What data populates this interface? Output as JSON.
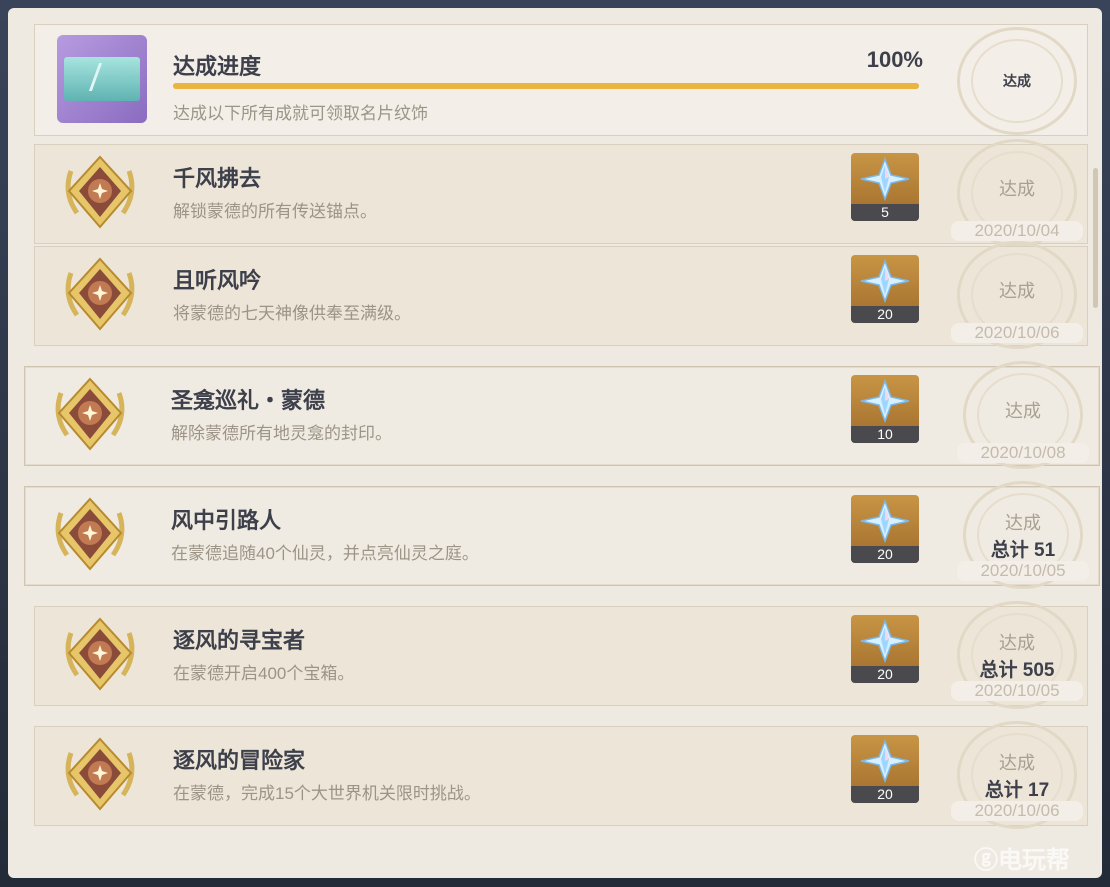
{
  "summary": {
    "title": "达成进度",
    "percent_text": "100%",
    "progress": 1.0,
    "description": "达成以下所有成就可领取名片纹饰",
    "stamp_label": "达成"
  },
  "achievements": [
    {
      "title": "千风拂去",
      "desc": "解锁蒙德的所有传送锚点。",
      "reward": "5",
      "stamp": "达成",
      "total": "",
      "date": "2020/10/04"
    },
    {
      "title": "且听风吟",
      "desc": "将蒙德的七天神像供奉至满级。",
      "reward": "20",
      "stamp": "达成",
      "total": "",
      "date": "2020/10/06"
    },
    {
      "title": "圣龛巡礼・蒙德",
      "desc": "解除蒙德所有地灵龛的封印。",
      "reward": "10",
      "stamp": "达成",
      "total": "",
      "date": "2020/10/08"
    },
    {
      "title": "风中引路人",
      "desc": "在蒙德追随40个仙灵，并点亮仙灵之庭。",
      "reward": "20",
      "stamp": "达成",
      "total": "总计 51",
      "date": "2020/10/05"
    },
    {
      "title": "逐风的寻宝者",
      "desc": "在蒙德开启400个宝箱。",
      "reward": "20",
      "stamp": "达成",
      "total": "总计 505",
      "date": "2020/10/05"
    },
    {
      "title": "逐风的冒险家",
      "desc": "在蒙德，完成15个大世界机关限时挑战。",
      "reward": "20",
      "stamp": "达成",
      "total": "总计 17",
      "date": "2020/10/06"
    }
  ],
  "icons": {
    "badge": "achievement-medal-icon",
    "reward": "primogem-icon"
  },
  "colors": {
    "progress_fill": "#e9b43f",
    "panel_bg": "#efeae1",
    "reward_bg": "#b27d36"
  },
  "watermark": "ⓖ电玩帮"
}
